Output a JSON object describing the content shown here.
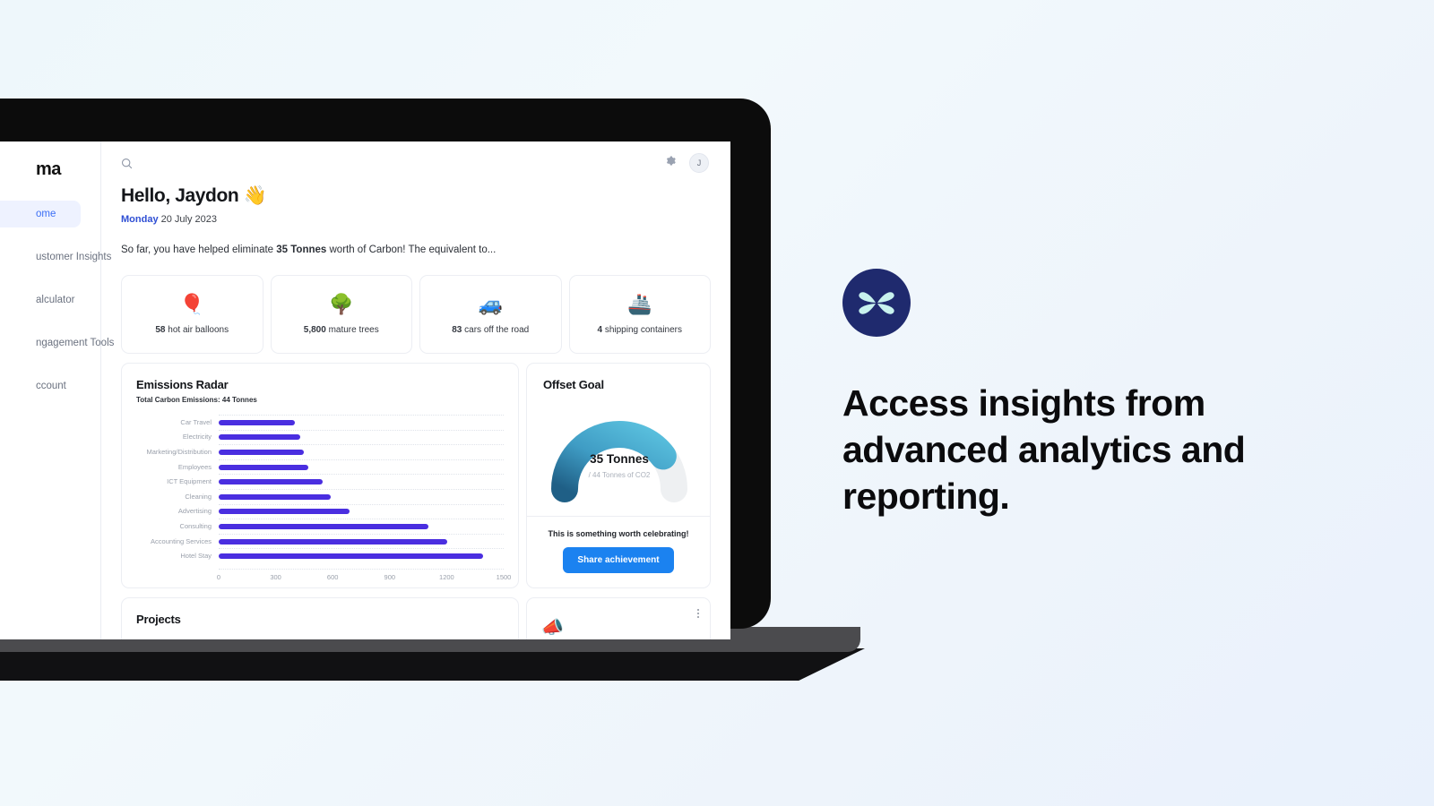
{
  "app": {
    "brand": "ma",
    "sidebar": {
      "items": [
        {
          "label": "ome",
          "active": true
        },
        {
          "label": "ustomer Insights",
          "active": false
        },
        {
          "label": "alculator",
          "active": false
        },
        {
          "label": "ngagement Tools",
          "active": false
        },
        {
          "label": "ccount",
          "active": false
        }
      ]
    },
    "topbar": {
      "search_icon": "search-icon",
      "settings_icon": "gear-icon",
      "avatar_initial": "J"
    },
    "greeting": "Hello, Jaydon 👋",
    "date_day": "Monday",
    "date_rest": " 20 July 2023",
    "tagline_pre": "So far, you have helped eliminate ",
    "tagline_bold": "35 Tonnes",
    "tagline_post": " worth of Carbon! The equivalent to...",
    "equivalences": [
      {
        "emoji": "🎈",
        "value": "58",
        "unit": " hot air balloons",
        "icon": "hot-air-balloon-icon"
      },
      {
        "emoji": "🌳",
        "value": "5,800",
        "unit": " mature trees",
        "icon": "tree-icon"
      },
      {
        "emoji": "🚙",
        "value": "83",
        "unit": " cars off the road",
        "icon": "car-icon"
      },
      {
        "emoji": "🚢",
        "value": "4",
        "unit": " shipping containers",
        "icon": "shipping-container-icon"
      }
    ],
    "chart_card": {
      "title": "Emissions Radar",
      "subtitle": "Total Carbon Emissions: 44 Tonnes"
    },
    "goal_card": {
      "title": "Offset Goal",
      "gauge_value": "35 Tonnes",
      "gauge_sub": "/ 44 Tonnes of CO2",
      "celebrate": "This is something worth celebrating!",
      "share_label": "Share achievement",
      "gauge_pct": 79.5,
      "gauge_color_start": "#1f5f86",
      "gauge_color_end": "#5cc3e0",
      "gauge_track": "#eef0f2"
    },
    "projects_card": {
      "title": "Projects"
    },
    "promo_card": {
      "emoji": "📣",
      "icon": "megaphone-icon",
      "menu_icon": "kebab-menu-icon"
    }
  },
  "marketing": {
    "logo_icon": "butterfly-logo-icon",
    "logo_bg": "#1f2a6e",
    "logo_fg": "#c8f2ee",
    "headline": "Access insights from advanced analytics and reporting."
  },
  "chart_data": {
    "type": "bar",
    "orientation": "horizontal",
    "title": "Emissions Radar",
    "subtitle": "Total Carbon Emissions: 44 Tonnes",
    "xlabel": "",
    "ylabel": "",
    "xlim": [
      0,
      1500
    ],
    "xticks": [
      0,
      300,
      600,
      900,
      1200,
      1500
    ],
    "grid": true,
    "bar_color": "#4a2ee0",
    "categories": [
      "Car Travel",
      "Electricity",
      "Marketing/Distribution",
      "Employees",
      "ICT Equipment",
      "Cleaning",
      "Advertising",
      "Consulting",
      "Accounting Services",
      "Hotel Stay"
    ],
    "values": [
      400,
      430,
      450,
      470,
      545,
      590,
      690,
      1105,
      1205,
      1390
    ]
  }
}
